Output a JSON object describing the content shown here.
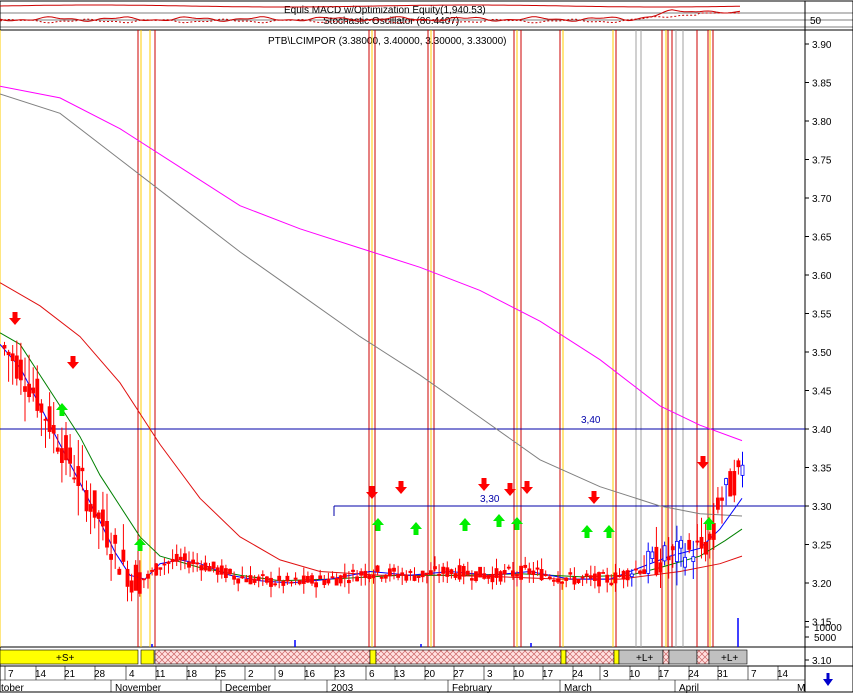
{
  "header": {
    "indicator_line": "Equis  MACD  w/Optimization Equity(1,940.53)",
    "oscillator_line": "Stochastic Oscillator (86.4407)",
    "oscillator_level": "50",
    "security_line": "PTB\\LCIMPOR (3.38000, 3.40000, 3.30000, 3.33000)"
  },
  "chart_data": {
    "type": "candlestick",
    "y_ticks": [
      "3.90",
      "3.85",
      "3.80",
      "3.75",
      "3.70",
      "3.65",
      "3.60",
      "3.55",
      "3.50",
      "3.45",
      "3.40",
      "3.35",
      "3.30",
      "3.25",
      "3.20",
      "3.15",
      "3.10"
    ],
    "ylim": [
      3.09,
      3.92
    ],
    "volume_ticks": [
      "10000",
      "5000"
    ],
    "x_day_ticks": [
      "7",
      "14",
      "21",
      "28",
      "4",
      "11",
      "18",
      "25",
      "2",
      "9",
      "16",
      "23",
      "6",
      "13",
      "20",
      "27",
      "3",
      "10",
      "17",
      "24",
      "3",
      "10",
      "17",
      "24",
      "31",
      "7",
      "14",
      "21",
      "28"
    ],
    "x_month_labels": [
      "tober",
      "November",
      "December",
      "2003",
      "February",
      "March",
      "April"
    ],
    "x_month_tail": "M",
    "levels": [
      {
        "label": "3,40",
        "value": 3.4
      },
      {
        "label": "3,30",
        "value": 3.3
      }
    ],
    "position_bar_labels": [
      "+S+",
      "+L+",
      "+L+"
    ],
    "colors": {
      "up": "#0000ff",
      "down": "#ff0000",
      "ma_magenta": "#ff00ff",
      "ma_gray": "#808080",
      "ma_red": "#e01010",
      "ma_green": "#008000",
      "ma_blue": "#0000ff",
      "buy_arrow": "#00ee00",
      "sell_arrow": "#ff0000",
      "signal_red": "#cc0000",
      "signal_yellow": "#ffcc00",
      "position_short": "#ffff00"
    },
    "series": [
      {
        "kind": "ma_magenta",
        "points": [
          [
            0,
            3.845
          ],
          [
            60,
            3.83
          ],
          [
            120,
            3.79
          ],
          [
            180,
            3.74
          ],
          [
            240,
            3.69
          ],
          [
            300,
            3.66
          ],
          [
            360,
            3.635
          ],
          [
            420,
            3.61
          ],
          [
            480,
            3.58
          ],
          [
            540,
            3.54
          ],
          [
            600,
            3.49
          ],
          [
            660,
            3.43
          ],
          [
            700,
            3.405
          ],
          [
            742,
            3.385
          ]
        ]
      },
      {
        "kind": "ma_gray",
        "points": [
          [
            0,
            3.835
          ],
          [
            60,
            3.81
          ],
          [
            120,
            3.75
          ],
          [
            180,
            3.69
          ],
          [
            240,
            3.63
          ],
          [
            300,
            3.575
          ],
          [
            360,
            3.52
          ],
          [
            420,
            3.47
          ],
          [
            480,
            3.415
          ],
          [
            540,
            3.36
          ],
          [
            600,
            3.325
          ],
          [
            660,
            3.3
          ],
          [
            700,
            3.29
          ],
          [
            742,
            3.287
          ]
        ]
      },
      {
        "kind": "ma_red",
        "points": [
          [
            0,
            3.59
          ],
          [
            40,
            3.56
          ],
          [
            80,
            3.52
          ],
          [
            120,
            3.46
          ],
          [
            160,
            3.38
          ],
          [
            200,
            3.31
          ],
          [
            240,
            3.26
          ],
          [
            280,
            3.23
          ],
          [
            320,
            3.215
          ],
          [
            380,
            3.21
          ],
          [
            440,
            3.21
          ],
          [
            500,
            3.208
          ],
          [
            560,
            3.205
          ],
          [
            620,
            3.205
          ],
          [
            680,
            3.215
          ],
          [
            720,
            3.225
          ],
          [
            742,
            3.235
          ]
        ]
      },
      {
        "kind": "ma_green",
        "points": [
          [
            0,
            3.525
          ],
          [
            20,
            3.51
          ],
          [
            40,
            3.47
          ],
          [
            60,
            3.43
          ],
          [
            80,
            3.39
          ],
          [
            100,
            3.34
          ],
          [
            120,
            3.3
          ],
          [
            140,
            3.26
          ],
          [
            160,
            3.235
          ],
          [
            200,
            3.22
          ],
          [
            240,
            3.21
          ],
          [
            280,
            3.203
          ],
          [
            330,
            3.205
          ],
          [
            400,
            3.21
          ],
          [
            460,
            3.21
          ],
          [
            520,
            3.212
          ],
          [
            580,
            3.208
          ],
          [
            630,
            3.21
          ],
          [
            660,
            3.22
          ],
          [
            700,
            3.235
          ],
          [
            725,
            3.255
          ],
          [
            742,
            3.27
          ]
        ]
      },
      {
        "kind": "ma_blue",
        "points": [
          [
            0,
            3.51
          ],
          [
            20,
            3.48
          ],
          [
            40,
            3.43
          ],
          [
            60,
            3.38
          ],
          [
            80,
            3.33
          ],
          [
            100,
            3.28
          ],
          [
            115,
            3.24
          ],
          [
            130,
            3.21
          ],
          [
            145,
            3.205
          ],
          [
            160,
            3.225
          ],
          [
            180,
            3.23
          ],
          [
            200,
            3.225
          ],
          [
            230,
            3.21
          ],
          [
            260,
            3.203
          ],
          [
            290,
            3.2
          ],
          [
            330,
            3.205
          ],
          [
            370,
            3.215
          ],
          [
            410,
            3.21
          ],
          [
            450,
            3.215
          ],
          [
            490,
            3.21
          ],
          [
            530,
            3.215
          ],
          [
            570,
            3.205
          ],
          [
            610,
            3.205
          ],
          [
            640,
            3.22
          ],
          [
            670,
            3.235
          ],
          [
            700,
            3.245
          ],
          [
            720,
            3.27
          ],
          [
            742,
            3.31
          ]
        ]
      }
    ]
  }
}
